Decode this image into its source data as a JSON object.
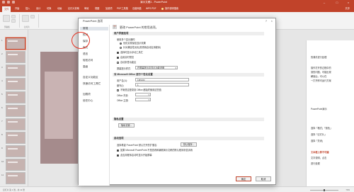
{
  "window": {
    "title": "演示文稿1 - PowerPoint"
  },
  "tabs": [
    "文件",
    "开始",
    "插入",
    "设计",
    "切换",
    "动画",
    "幻灯片放映",
    "审阅",
    "视图",
    "加载项",
    "PDF工具集",
    "百度网盘",
    "WPS PDF"
  ],
  "active_tab_index": 0,
  "tellme": "操作说明搜索",
  "share": "共享",
  "ribbon_groups": [
    "剪贴板",
    "幻灯片"
  ],
  "thumbnails": [
    "1",
    "2",
    "3",
    "4",
    "5",
    "6",
    "7",
    "8",
    "9",
    "10",
    "11",
    "12"
  ],
  "document_text": {
    "lines": [
      "的课件进行处理",
      "",
      "操作打开的过程中的",
      "到的问题，可能出现",
      "解锁后，可以在",
      "一打开即可运行方案",
      "",
      "PowerPoint演示",
      "",
      "选择「格式」「颜色」",
      "选择「幻灯片」",
      "选择「关闭」",
      "",
      "文本框上移不可编",
      "文字说明，点击",
      "进行处理"
    ],
    "accent_line": "文本框上移不可编"
  },
  "dialog": {
    "title": "PowerPoint 选项",
    "help": "?",
    "close": "×",
    "header": "更改 PowerPoint 的常用选项。",
    "nav": [
      "常规",
      "校对",
      "保存",
      "版式",
      "语言",
      "轻松访问",
      "高级",
      "",
      "自定义功能区",
      "快速访问工具栏",
      "",
      "加载项",
      "信任中心"
    ],
    "active_nav_index": 0,
    "sections": {
      "ui": {
        "title": "用户界面选项",
        "sub": "使用多个显示器时:",
        "radio1": "优化实现最佳显示效果",
        "radio2": "针对兼容性优化(需重新启动应用程序)",
        "check1": "选择时显示浮动工具栏",
        "check2": "启用实时预览",
        "check3": "自动折叠功能区",
        "tooltip_label": "屏幕提示样式:",
        "tooltip_value": "在屏幕提示中显示功能说明"
      },
      "personalize": {
        "title": "对 Microsoft Office 进行个性化设置",
        "username_label": "用户名(U):",
        "username_value": "Lenovo",
        "initials_label": "缩写(I):",
        "initials_value": "L",
        "check_always": "不管是否登录到 Office 都始终使用这些值",
        "bg_label": "Office 背景:",
        "theme_label": "Office 主题:"
      },
      "privacy": {
        "title": "隐私设置",
        "button": "隐私设置..."
      },
      "startup": {
        "title": "启动选项",
        "line": "选择希望 PowerPoint 默认打开的扩展名:",
        "default_button": "默认程序...",
        "check_default": "如果 Microsoft PowerPoint 不是查看和编辑演示文稿的默认程序则告诉我",
        "check_startscreen": "此应用程序启动时显示开始屏幕"
      }
    },
    "ok": "确定",
    "cancel": "取消"
  },
  "status": {
    "left": "幻灯片 第 1 张，共 12 张",
    "zoom": "70%"
  },
  "colors": {
    "accent": "#c1432a",
    "oval": "#e53020"
  }
}
